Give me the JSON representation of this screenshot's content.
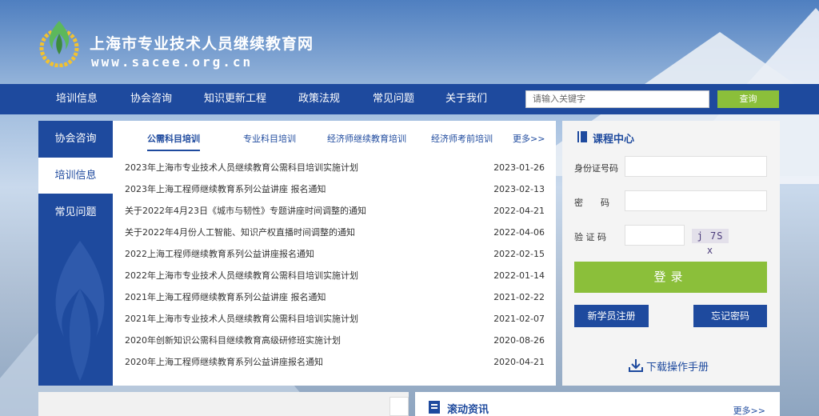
{
  "header": {
    "site_title": "上海市专业技术人员继续教育网",
    "site_url": "www.sacee.org.cn"
  },
  "nav": {
    "items": [
      "培训信息",
      "协会咨询",
      "知识更新工程",
      "政策法规",
      "常见问题",
      "关于我们"
    ],
    "search_placeholder": "请输入关键字",
    "search_button": "查询"
  },
  "sidebar": {
    "items": [
      {
        "label": "协会咨询",
        "active": false
      },
      {
        "label": "培训信息",
        "active": true
      },
      {
        "label": "常见问题",
        "active": false
      }
    ]
  },
  "news": {
    "tabs": [
      {
        "label": "公需科目培训",
        "active": true
      },
      {
        "label": "专业科目培训",
        "active": false
      },
      {
        "label": "经济师继续教育培训",
        "active": false
      },
      {
        "label": "经济师考前培训",
        "active": false
      }
    ],
    "more": "更多>>",
    "rows": [
      {
        "title": "2023年上海市专业技术人员继续教育公需科目培训实施计划",
        "date": "2023-01-26"
      },
      {
        "title": "2023年上海工程师继续教育系列公益讲座 报名通知",
        "date": "2023-02-13"
      },
      {
        "title": "关于2022年4月23日《城市与韧性》专题讲座时间调整的通知",
        "date": "2022-04-21"
      },
      {
        "title": "关于2022年4月份人工智能、知识产权直播时间调整的通知",
        "date": "2022-04-06"
      },
      {
        "title": "2022上海工程师继续教育系列公益讲座报名通知",
        "date": "2022-02-15"
      },
      {
        "title": "2022年上海市专业技术人员继续教育公需科目培训实施计划",
        "date": "2022-01-14"
      },
      {
        "title": "2021年上海工程师继续教育系列公益讲座 报名通知",
        "date": "2021-02-22"
      },
      {
        "title": "2021年上海市专业技术人员继续教育公需科目培训实施计划",
        "date": "2021-02-07"
      },
      {
        "title": "2020年创新知识公需科目继续教育高级研修班实施计划",
        "date": "2020-08-26"
      },
      {
        "title": "2020年上海工程师继续教育系列公益讲座报名通知",
        "date": "2020-04-21"
      }
    ]
  },
  "login": {
    "title": "课程中心",
    "id_label": "身份证号码",
    "password_label": "密　　码",
    "captcha_label": "验 证 码",
    "captcha_text": "j 7S x",
    "login_button": "登录",
    "register_button": "新学员注册",
    "forgot_button": "忘记密码",
    "download_label": "下载操作手册"
  },
  "scroll_news": {
    "title": "滚动资讯",
    "more": "更多>>"
  },
  "colors": {
    "primary": "#1e4a9e",
    "accent_green": "#8bbf3a",
    "panel_bg": "#f4f4f4"
  }
}
